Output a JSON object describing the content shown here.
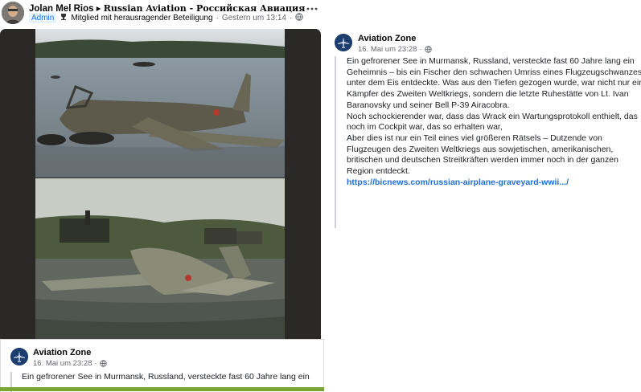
{
  "header": {
    "author": "Jolan Mel Rios",
    "arrow": "▸",
    "group": "Russian Aviation - Российская Авиация",
    "admin_badge": "Admin",
    "member_badge": "Mitglied mit herausragender Beteiligung",
    "timestamp": "Gestern um 13:14",
    "separator": "·",
    "more_icon": "more-icon"
  },
  "shared_post": {
    "page_name": "Aviation Zone",
    "time": "16. Mai um 23:28",
    "separator": "·",
    "text_line1": "Ein gefrorener See in Murmansk, Russland, versteckte fast 60 Jahre lang ein"
  },
  "right_post": {
    "page_name": "Aviation Zone",
    "time": "16. Mai um 23:28",
    "separator": "·",
    "paragraphs": [
      "Ein gefrorener See in Murmansk, Russland, versteckte fast 60 Jahre lang ein Geheimnis – bis ein Fischer den schwachen Umriss eines Flugzeugschwanzes unter dem Eis entdeckte. Was aus den Tiefen gezogen wurde, war nicht nur ein Kämpfer des Zweiten Weltkriegs, sondern die letzte Ruhestätte von Lt. Ivan Baranovsky und seiner Bell P-39 Airacobra.",
      "Noch schockierender war, dass das Wrack ein Wartungsprotokoll enthielt, das noch im Cockpit war, das so erhalten war,",
      "Aber dies ist nur ein Teil eines viel größeren Rätsels – Dutzende von Flugzeugen des Zweiten Weltkriegs aus sowjetischen, amerikanischen, britischen und deutschen Streitkräften werden immer noch in der ganzen Region entdeckt."
    ],
    "link": "https://bicnews.com/russian-airplane-graveyard-wwii.../"
  },
  "colors": {
    "link": "#216fdb",
    "admin_bg": "#e7f3ff",
    "admin_text": "#1877f2",
    "page_logo": "#1c3d6e",
    "photo_frame": "#2a2927"
  }
}
